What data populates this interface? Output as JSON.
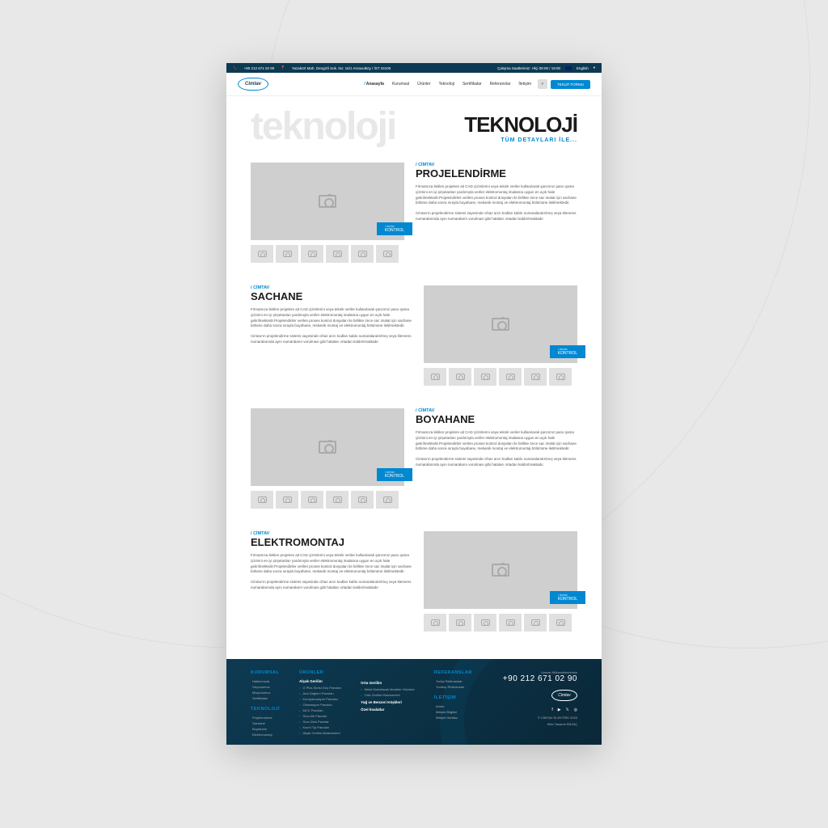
{
  "topbar": {
    "phone": "+90 212 671 02 90",
    "address": "Yazakört Mah. Dengizli Sok. No: 16/1 Arnavutköy / İST 34100",
    "hours": "Çalışma Saatlerimiz: Hİçi 09:00 / 19:00",
    "lang": "English"
  },
  "header": {
    "logo": "Cimtav",
    "nav": [
      "Anasayfa",
      "Kurumsal",
      "Ürünler",
      "Teknoloji",
      "Sertifikalar",
      "Referanslar",
      "İletişim"
    ],
    "cta": "TEKLİF FORMU"
  },
  "hero": {
    "bg": "teknoloji",
    "title": "TEKNOLOJİ",
    "subtitle": "TÜM DETAYLARI İLE..."
  },
  "sections": [
    {
      "tag": "CİMTAV",
      "title": "PROJELENDİRME",
      "badge_small": "/ cimtav",
      "badge": "KONTROL",
      "p1": "Firmamıza iletilen projelere ait CAD çizimlerini veya teknik veriler kullanılarak şanzımız pano şama çizimini en iyi şirşetanları yardımıyla veriler elektromontaj imalatına uygun en açık hale getirilmektedir.Projelendiriler verilen proses kontrol dosyaları ile birlikte önce sac imalat için sachane bölüme daha sonra sırayla boyahane, mekanik montaj ve elektromontaj bölümüne iletilmektedir.",
      "p2": "Cimtav'ın projelendirme sistemi sayesinde cihaz arızı kodları kablo numaralandırılmış veya klemens numaralarında aynı numaraların vurulması gibi hataları ortadan kaldırılmaktadır."
    },
    {
      "tag": "CİMTAV",
      "title": "SACHANE",
      "badge_small": "/ cimtav",
      "badge": "KONTROL",
      "p1": "Firmamıza iletilen projelere ait CAD çizimlerini veya teknik veriler kullanılarak şanzımız pano şama çizimini en iyi şirşetanları yardımıyla veriler elektromontaj imalatına uygun en açık hale getirilmektedir.Projelendiriler verilen proses kontrol dosyaları ile birlikte önce sac imalat için sachane bölüme daha sonra sırayla boyahane, mekanik montaj ve elektromontaj bölümüne iletilmektedir.",
      "p2": "Cimtav'ın projelendirme sistemi sayesinde cihaz arızı kodları kablo numaralandırılmış veya klemens numaralarında aynı numaraların vurulması gibi hataları ortadan kaldırılmaktadır."
    },
    {
      "tag": "CİMTAV",
      "title": "BOYAHANE",
      "badge_small": "/ cimtav",
      "badge": "KONTROL",
      "p1": "Firmamıza iletilen projelere ait CAD çizimlerini veya teknik veriler kullanılarak şanzımız pano şama çizimini en iyi şirşetanları yardımıyla veriler elektromontaj imalatına uygun en açık hale getirilmektedir.Projelendiriler verilen proses kontrol dosyaları ile birlikte önce sac imalat için sachane bölüme daha sonra sırayla boyahane, mekanik montaj ve elektromontaj bölümüne iletilmektedir.",
      "p2": "Cimtav'ın projelendirme sistemi sayesinde cihaz arızı kodları kablo numaralandırılmış veya klemens numaralarında aynı numaraların vurulması gibi hataları ortadan kaldırılmaktadır."
    },
    {
      "tag": "CİMTAV",
      "title": "ELEKTROMONTAJ",
      "badge_small": "/ cimtav",
      "badge": "KONTROL",
      "p1": "Firmamıza iletilen projelere ait CAD çizimlerini veya teknik veriler kullanılarak şanzımız pano şama çizimini en iyi şirşetanları yardımıyla veriler elektromontaj imalatına uygun en açık hale getirilmektedir.Projelendiriler verilen proses kontrol dosyaları ile birlikte önce sac imalat için sachane bölüme daha sonra sırayla boyahane, mekanik montaj ve elektromontaj bölümüne iletilmektedir.",
      "p2": "Cimtav'ın projelendirme sistemi sayesinde cihaz arızı kodları kablo numaralandırılmış veya klemens numaralarında aynı numaraların vurulması gibi hataları ortadan kaldırılmaktadır."
    }
  ],
  "footer": {
    "cols": [
      {
        "title": "KURUMSAL",
        "items": [
          "Hakkımızda",
          "Vizyonumuz",
          "Misyonumuz",
          "Sertifikalar"
        ]
      },
      {
        "title": "TEKNOLOJİ",
        "items": [
          "Projelendirme",
          "Sachane",
          "Boyahane",
          "Elektromontaj"
        ]
      },
      {
        "title": "ÜRÜNLER",
        "sub1": "Alçak Gerilim",
        "items1": [
          "G Plus Serisi Güç Panoları",
          "Ana Dağıtım Panoları",
          "Kompanzasyon Panoları",
          "Otomasyon Panoları",
          "MCC Panoları",
          "Sıva Altı Panolar",
          "Sıva Üstü Panolar",
          "Kısmî Tip Panoları",
          "Alçak Gerilim Malzemeleri"
        ]
      },
      {
        "sub1": "Orta Gerilim",
        "items1": [
          "Metal Muhafazalı Modüler Hücreler",
          "Orta Gerilim Malzemeleri"
        ],
        "sub2": "Yağ ve Benzeri Köşkleri",
        "sub3": "Özel İmalatlar"
      },
      {
        "title": "REFERANSLAR",
        "items": [
          "Yurtiçi Referanslar",
          "Yurtdışı Referanslar"
        ]
      },
      {
        "title": "İLETİŞİM",
        "items": [
          "Adres",
          "İletişim Bilgileri",
          "İletişim Haritası"
        ]
      }
    ],
    "phone_label": "Uzman Mühendislerimize",
    "phone": "+90 212 671 02 90",
    "copyright": "© CİMTAV ELEKTRİK 2020",
    "web": "Web Tasarım BİLİNÇ"
  }
}
